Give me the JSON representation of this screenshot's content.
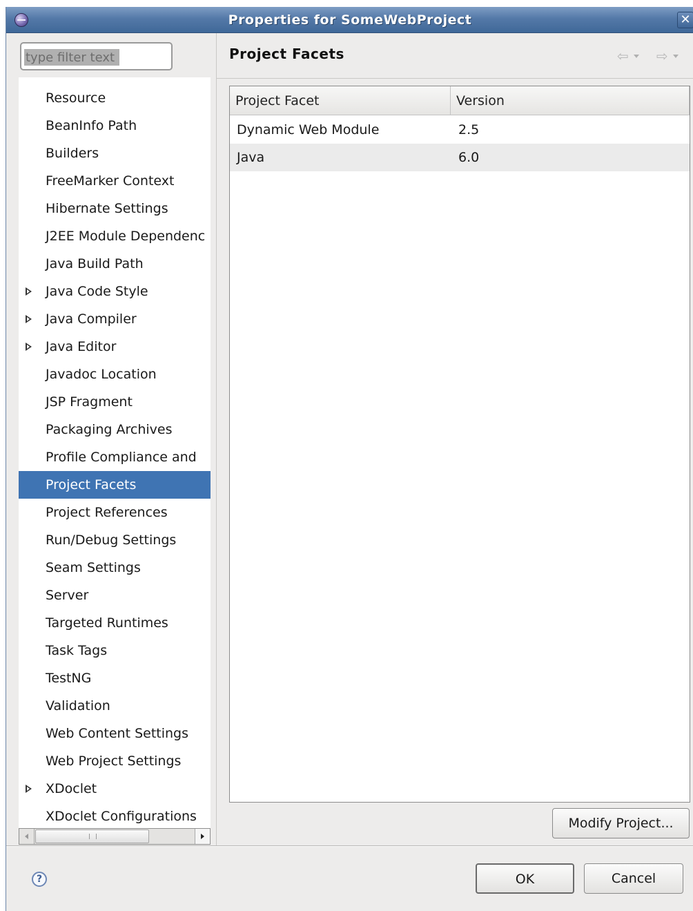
{
  "window": {
    "title": "Properties for SomeWebProject",
    "close_glyph": "✕"
  },
  "filter": {
    "placeholder": "type filter text"
  },
  "tree": {
    "items": [
      {
        "label": "Resource",
        "expandable": false,
        "selected": false
      },
      {
        "label": "BeanInfo Path",
        "expandable": false,
        "selected": false
      },
      {
        "label": "Builders",
        "expandable": false,
        "selected": false
      },
      {
        "label": "FreeMarker Context",
        "expandable": false,
        "selected": false
      },
      {
        "label": "Hibernate Settings",
        "expandable": false,
        "selected": false
      },
      {
        "label": "J2EE Module Dependenc",
        "expandable": false,
        "selected": false
      },
      {
        "label": "Java Build Path",
        "expandable": false,
        "selected": false
      },
      {
        "label": "Java Code Style",
        "expandable": true,
        "selected": false
      },
      {
        "label": "Java Compiler",
        "expandable": true,
        "selected": false
      },
      {
        "label": "Java Editor",
        "expandable": true,
        "selected": false
      },
      {
        "label": "Javadoc Location",
        "expandable": false,
        "selected": false
      },
      {
        "label": "JSP Fragment",
        "expandable": false,
        "selected": false
      },
      {
        "label": "Packaging Archives",
        "expandable": false,
        "selected": false
      },
      {
        "label": "Profile Compliance and",
        "expandable": false,
        "selected": false
      },
      {
        "label": "Project Facets",
        "expandable": false,
        "selected": true
      },
      {
        "label": "Project References",
        "expandable": false,
        "selected": false
      },
      {
        "label": "Run/Debug Settings",
        "expandable": false,
        "selected": false
      },
      {
        "label": "Seam Settings",
        "expandable": false,
        "selected": false
      },
      {
        "label": "Server",
        "expandable": false,
        "selected": false
      },
      {
        "label": "Targeted Runtimes",
        "expandable": false,
        "selected": false
      },
      {
        "label": "Task Tags",
        "expandable": false,
        "selected": false
      },
      {
        "label": "TestNG",
        "expandable": false,
        "selected": false
      },
      {
        "label": "Validation",
        "expandable": false,
        "selected": false
      },
      {
        "label": "Web Content Settings",
        "expandable": false,
        "selected": false
      },
      {
        "label": "Web Project Settings",
        "expandable": false,
        "selected": false
      },
      {
        "label": "XDoclet",
        "expandable": true,
        "selected": false
      },
      {
        "label": "XDoclet Configurations",
        "expandable": false,
        "selected": false
      }
    ]
  },
  "page": {
    "title": "Project Facets",
    "nav_back_glyph": "⇦",
    "nav_forward_glyph": "⇨"
  },
  "facets_table": {
    "columns": [
      "Project Facet",
      "Version"
    ],
    "rows": [
      {
        "facet": "Dynamic Web Module",
        "version": "2.5"
      },
      {
        "facet": "Java",
        "version": "6.0"
      }
    ]
  },
  "buttons": {
    "modify_project": "Modify Project...",
    "ok": "OK",
    "cancel": "Cancel",
    "help_glyph": "?"
  },
  "colors": {
    "titlebar": "#4f74a3",
    "selection": "#3f74b3",
    "dialog_bg": "#edeceb"
  }
}
